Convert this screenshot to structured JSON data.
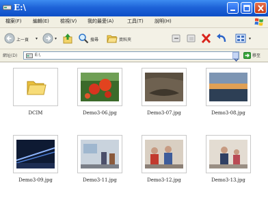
{
  "window": {
    "title": "E:\\"
  },
  "menu": [
    "檔案(F)",
    "編輯(E)",
    "檢視(V)",
    "我的最愛(A)",
    "工具(T)",
    "說明(H)"
  ],
  "toolbar": {
    "back": "上一頁",
    "search": "搜尋",
    "folders": "資料夾"
  },
  "address": {
    "label": "網址(D)",
    "value": "E:\\",
    "go": "移至"
  },
  "files": [
    {
      "name": "DCIM",
      "kind": "folder"
    },
    {
      "name": "Demo3-06.jpg",
      "kind": "image"
    },
    {
      "name": "Demo3-07.jpg",
      "kind": "image"
    },
    {
      "name": "Demo3-08.jpg",
      "kind": "image"
    },
    {
      "name": "Demo3-09.jpg",
      "kind": "image"
    },
    {
      "name": "Demo3-11.jpg",
      "kind": "image"
    },
    {
      "name": "Demo3-12.jpg",
      "kind": "image"
    },
    {
      "name": "Demo3-13.jpg",
      "kind": "image"
    }
  ]
}
